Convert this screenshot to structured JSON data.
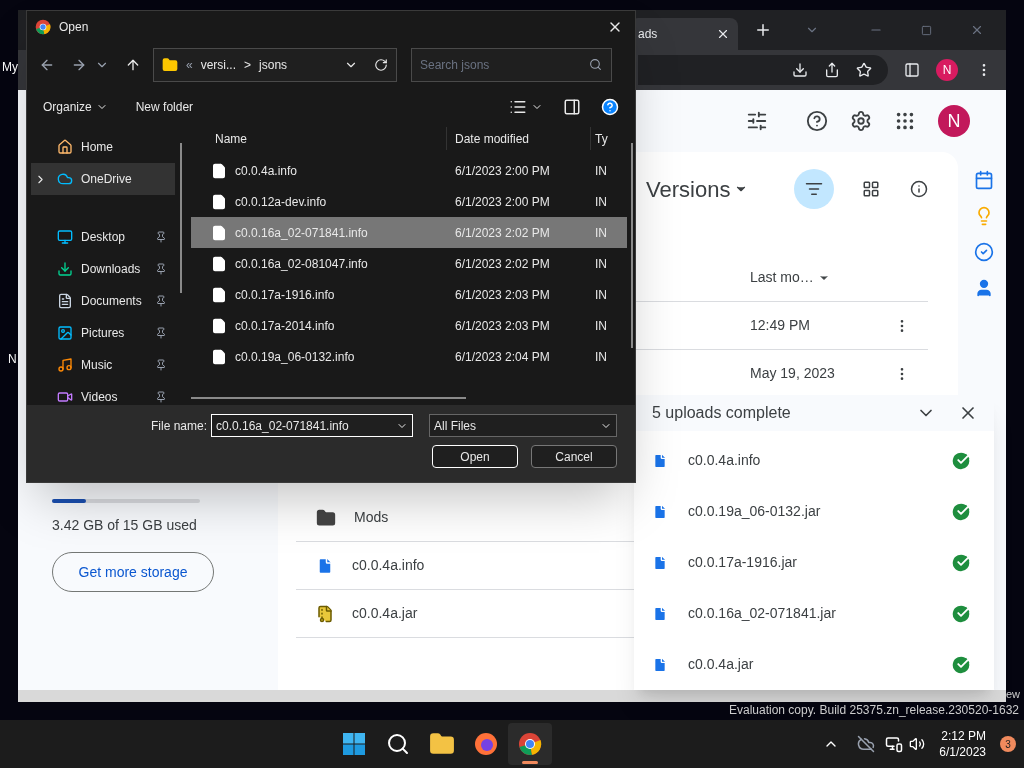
{
  "desktop": {
    "labels": [
      "My",
      "N"
    ],
    "edition_fragment": "ew",
    "watermark": "Evaluation copy. Build 25375.zn_release.230520-1632"
  },
  "browser": {
    "tab": {
      "title": "ads"
    },
    "profile_initial": "N",
    "drive": {
      "avatar_initial": "N",
      "heading": "Versions",
      "storage": {
        "level": 0.23,
        "text": "3.42 GB of 15 GB used",
        "button": "Get more storage"
      },
      "sort_column": "Last mo…",
      "top_rows": [
        {
          "modified": "12:49 PM"
        },
        {
          "modified": "May 19, 2023"
        }
      ],
      "rows": [
        {
          "kind": "folder",
          "name": "Mods"
        },
        {
          "kind": "doc",
          "name": "c0.0.4a.info"
        },
        {
          "kind": "archive",
          "name": "c0.0.4a.jar"
        }
      ],
      "uploads": {
        "title": "5 uploads complete",
        "items": [
          {
            "name": "c0.0.4a.info",
            "done": true
          },
          {
            "name": "c0.0.19a_06-0132.jar",
            "done": true
          },
          {
            "name": "c0.0.17a-1916.jar",
            "done": true
          },
          {
            "name": "c0.0.16a_02-071841.jar",
            "done": true
          },
          {
            "name": "c0.0.4a.jar",
            "done": true
          }
        ]
      }
    }
  },
  "dialog": {
    "title": "Open",
    "path": {
      "overflow": "«",
      "parent": "versi...",
      "separator": ">",
      "current": "jsons"
    },
    "search": {
      "placeholder": "Search jsons"
    },
    "commands": {
      "organize": "Organize",
      "new_folder": "New folder"
    },
    "nav": [
      {
        "kind": "home",
        "label": "Home",
        "selected": false,
        "pinned": false,
        "expandable": false
      },
      {
        "kind": "cloud",
        "label": "OneDrive",
        "selected": true,
        "pinned": false,
        "expandable": true
      },
      {
        "kind": "desktop",
        "label": "Desktop",
        "selected": false,
        "pinned": true,
        "expandable": false
      },
      {
        "kind": "downloads",
        "label": "Downloads",
        "selected": false,
        "pinned": true,
        "expandable": false
      },
      {
        "kind": "documents",
        "label": "Documents",
        "selected": false,
        "pinned": true,
        "expandable": false
      },
      {
        "kind": "pictures",
        "label": "Pictures",
        "selected": false,
        "pinned": true,
        "expandable": false
      },
      {
        "kind": "music",
        "label": "Music",
        "selected": false,
        "pinned": true,
        "expandable": false
      },
      {
        "kind": "videos",
        "label": "Videos",
        "selected": false,
        "pinned": true,
        "expandable": false
      }
    ],
    "columns": [
      "Name",
      "Date modified",
      "Ty"
    ],
    "files": [
      {
        "name": "c0.0.4a.info",
        "date": "6/1/2023 2:00 PM",
        "type": "IN",
        "selected": false
      },
      {
        "name": "c0.0.12a-dev.info",
        "date": "6/1/2023 2:00 PM",
        "type": "IN",
        "selected": false
      },
      {
        "name": "c0.0.16a_02-071841.info",
        "date": "6/1/2023 2:02 PM",
        "type": "IN",
        "selected": true
      },
      {
        "name": "c0.0.16a_02-081047.info",
        "date": "6/1/2023 2:02 PM",
        "type": "IN",
        "selected": false
      },
      {
        "name": "c0.0.17a-1916.info",
        "date": "6/1/2023 2:03 PM",
        "type": "IN",
        "selected": false
      },
      {
        "name": "c0.0.17a-2014.info",
        "date": "6/1/2023 2:03 PM",
        "type": "IN",
        "selected": false
      },
      {
        "name": "c0.0.19a_06-0132.info",
        "date": "6/1/2023 2:04 PM",
        "type": "IN",
        "selected": false
      }
    ],
    "file_name_label": "File name:",
    "file_name": "c0.0.16a_02-071841.info",
    "filter": "All Files",
    "buttons": [
      "Open",
      "Cancel"
    ]
  },
  "taskbar": {
    "apps": [
      {
        "kind": "start",
        "active": false
      },
      {
        "kind": "search",
        "active": false
      },
      {
        "kind": "explorer",
        "active": false
      },
      {
        "kind": "firefox",
        "active": false
      },
      {
        "kind": "chrome",
        "active": true
      }
    ],
    "time": "2:12 PM",
    "date": "6/1/2023",
    "notifications": "3"
  }
}
